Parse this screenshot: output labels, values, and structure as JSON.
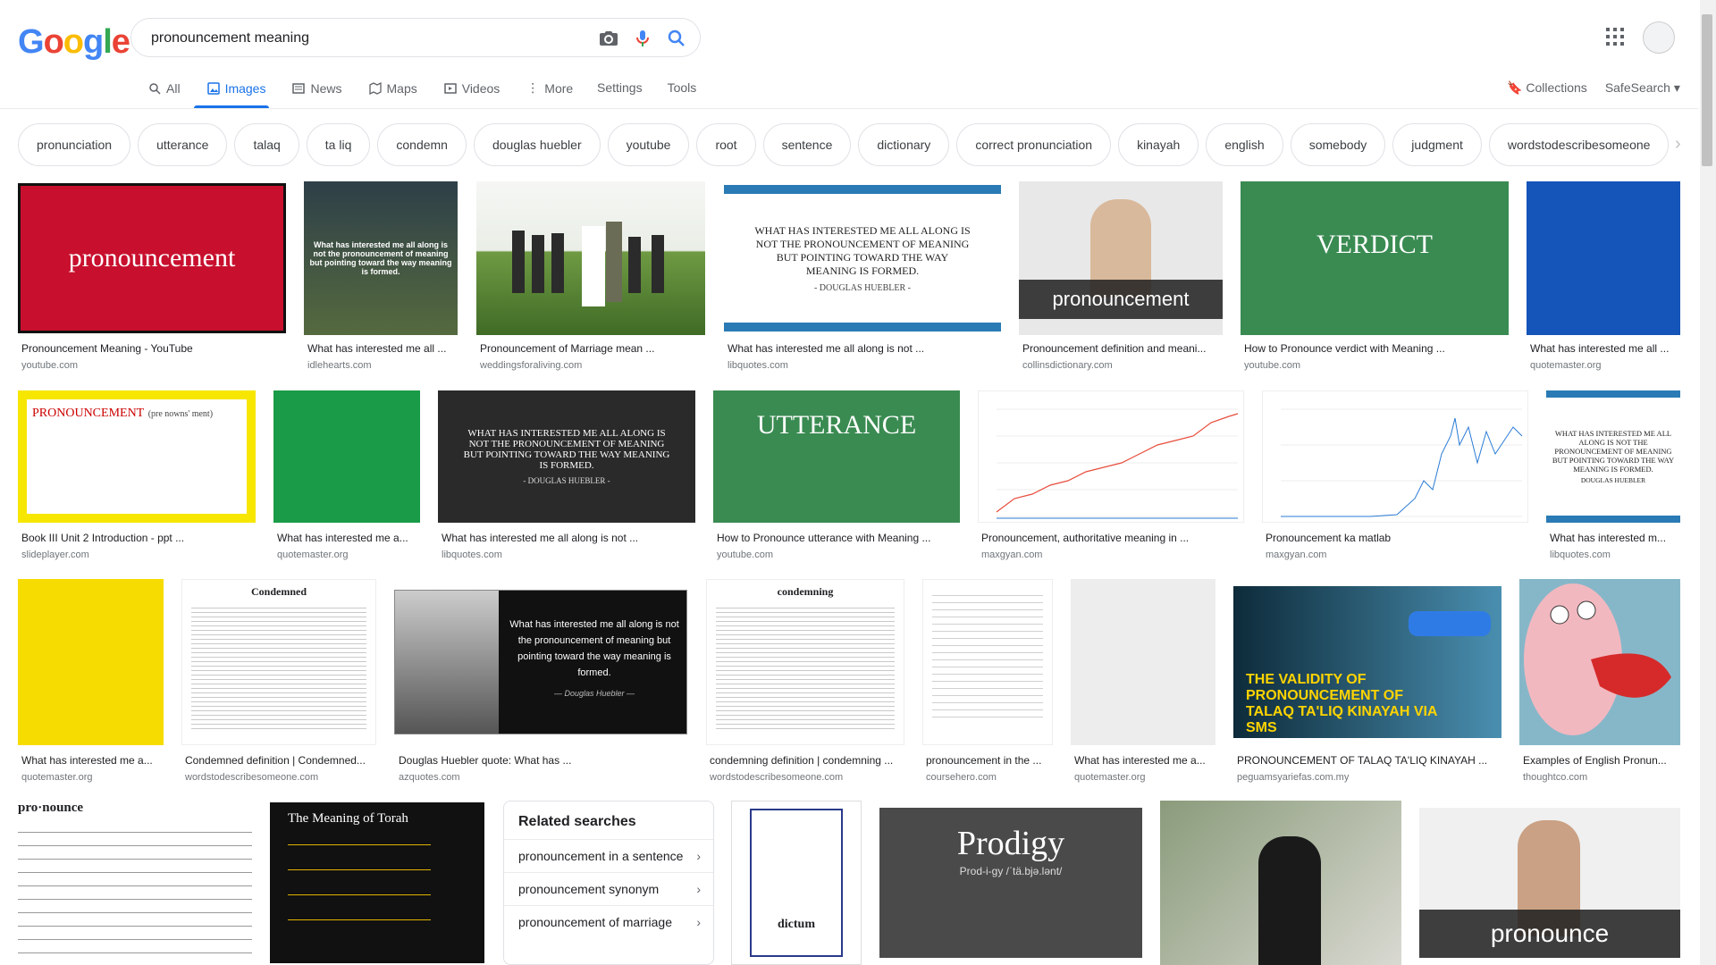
{
  "logo": {
    "letters": [
      "G",
      "o",
      "o",
      "g",
      "l",
      "e"
    ],
    "colors": [
      "#4285F4",
      "#EA4335",
      "#FBBC05",
      "#4285F4",
      "#34A853",
      "#EA4335"
    ]
  },
  "search": {
    "query": "pronouncement meaning"
  },
  "nav": {
    "tabs": [
      {
        "label": "All",
        "icon": "search-icon"
      },
      {
        "label": "Images",
        "icon": "image-icon",
        "active": true
      },
      {
        "label": "News",
        "icon": "news-icon"
      },
      {
        "label": "Maps",
        "icon": "map-icon"
      },
      {
        "label": "Videos",
        "icon": "video-icon"
      },
      {
        "label": "More",
        "icon": "more-icon"
      }
    ],
    "settings": "Settings",
    "tools": "Tools",
    "collections": "Collections",
    "safesearch": "SafeSearch"
  },
  "chips": [
    "pronunciation",
    "utterance",
    "talaq",
    "ta liq",
    "condemn",
    "douglas huebler",
    "youtube",
    "root",
    "sentence",
    "dictionary",
    "correct pronunciation",
    "kinayah",
    "english",
    "somebody",
    "judgment",
    "wordstodescribesomeone"
  ],
  "results": [
    {
      "caption": "Pronouncement Meaning - YouTube",
      "source": "youtube.com",
      "text": "pronouncement"
    },
    {
      "caption": "What has interested me all ...",
      "source": "idlehearts.com",
      "text": "What has interested me all along is not the pronouncement of meaning but pointing toward the way meaning is formed."
    },
    {
      "caption": "Pronouncement of Marriage mean ...",
      "source": "weddingsforaliving.com",
      "text": ""
    },
    {
      "caption": "What has interested me all along is not ...",
      "source": "libquotes.com",
      "text": "WHAT HAS INTERESTED ME ALL ALONG IS NOT THE PRONOUNCEMENT OF MEANING BUT POINTING TOWARD THE WAY MEANING IS FORMED.",
      "subtext": "- DOUGLAS HUEBLER -"
    },
    {
      "caption": "Pronouncement definition and meani...",
      "source": "collinsdictionary.com",
      "text": "pronouncement"
    },
    {
      "caption": "How to Pronounce verdict with Meaning ...",
      "source": "youtube.com",
      "text": "VERDICT"
    },
    {
      "caption": "What has interested me all ...",
      "source": "quotemaster.org",
      "text": ""
    },
    {
      "caption": "Book III Unit 2 Introduction - ppt ...",
      "source": "slideplayer.com",
      "text": "PRONOUNCEMENT",
      "subtext": "(pre nowns' ment)"
    },
    {
      "caption": "What has interested me a...",
      "source": "quotemaster.org",
      "text": ""
    },
    {
      "caption": "What has interested me all along is not ...",
      "source": "libquotes.com",
      "text": "WHAT HAS INTERESTED ME ALL ALONG IS NOT THE PRONOUNCEMENT OF MEANING BUT POINTING TOWARD THE WAY MEANING IS FORMED.",
      "subtext": "- DOUGLAS HUEBLER -"
    },
    {
      "caption": "How to Pronounce utterance with Meaning ...",
      "source": "youtube.com",
      "text": "UTTERANCE"
    },
    {
      "caption": "Pronouncement, authoritative meaning in ...",
      "source": "maxgyan.com",
      "text": ""
    },
    {
      "caption": "Pronouncement ka matlab",
      "source": "maxgyan.com",
      "text": ""
    },
    {
      "caption": "What has interested m...",
      "source": "libquotes.com",
      "text": "WHAT HAS INTERESTED ME ALL ALONG IS NOT THE PRONOUNCEMENT OF MEANING BUT POINTING TOWARD THE WAY MEANING IS FORMED.",
      "subtext": "DOUGLAS HUEBLER"
    },
    {
      "caption": "What has interested me a...",
      "source": "quotemaster.org",
      "text": ""
    },
    {
      "caption": "Condemned definition | Condemned...",
      "source": "wordstodescribesomeone.com",
      "text": "Condemned"
    },
    {
      "caption": "Douglas Huebler quote: What has ...",
      "source": "azquotes.com",
      "text": "What has interested me all along is not the pronouncement of meaning but pointing toward the way meaning is formed.",
      "subtext": "— Douglas Huebler —"
    },
    {
      "caption": "condemning definition | condemning ...",
      "source": "wordstodescribesomeone.com",
      "text": "condemning"
    },
    {
      "caption": "pronouncement in the ...",
      "source": "coursehero.com",
      "text": ""
    },
    {
      "caption": "What has interested me a...",
      "source": "quotemaster.org",
      "text": ""
    },
    {
      "caption": "PRONOUNCEMENT OF TALAQ TA'LIQ KINAYAH ...",
      "source": "peguamsyariefas.com.my",
      "text": "THE VALIDITY OF PRONOUNCEMENT OF TALAQ TA'LIQ KINAYAH VIA SMS"
    },
    {
      "caption": "Examples of English Pronun...",
      "source": "thoughtco.com",
      "text": ""
    }
  ],
  "bottom_row": {
    "dict_text": "pro·nounce",
    "torah_title": "The Meaning of Torah",
    "prodigy_title": "Prodigy",
    "prodigy_phon": "Prod-i-gy  /ˈtä.bjə.lənt/",
    "dictum_text": "dictum",
    "pronounce_text": "pronounce"
  },
  "related": {
    "title": "Related searches",
    "items": [
      "pronouncement in a sentence",
      "pronouncement synonym",
      "pronouncement of marriage"
    ]
  }
}
